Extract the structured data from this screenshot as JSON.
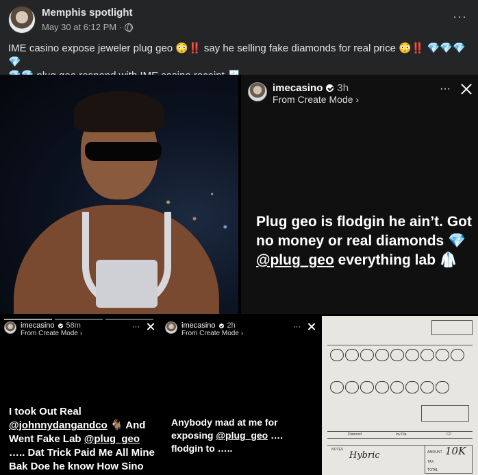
{
  "post": {
    "page_name": "Memphis spotlight",
    "date": "May 30 at 6:12 PM",
    "separator": "·",
    "more_label": "···",
    "caption_text_1": "IME casino expose jeweler plug geo 😳‼️ say he selling fake diamonds for real price 😳‼️ ",
    "caption_emoji_1": "💎💎💎💎",
    "caption_emoji_2": "💎💎",
    "caption_text_2": " plug geo respond with IME casino receipt 🧾"
  },
  "story_main": {
    "username": "imecasino",
    "time": "3h",
    "mode": "From Create Mode ›",
    "more_label": "···",
    "text_1": "Plug geo is flodgin he ain’t. Got no money or real diamonds 💎 ",
    "mention": "@plug_geo",
    "text_2": " everything lab 🥼"
  },
  "story_left": {
    "username": "imecasino",
    "time": "58m",
    "mode": "From Create Mode ›",
    "more_label": "···",
    "text_1": "I took Out Real ",
    "mention_1": "@johnnydangandco",
    "text_2": " 🐐 And Went Fake Lab ",
    "mention_2": "@plug_geo",
    "text_3": " ….. Dat Trick Paid Me All Mine Bak Doe he know How Sino Get"
  },
  "story_mid": {
    "username": "imecasino",
    "time": "2h",
    "mode": "From Create Mode ›",
    "more_label": "···",
    "text_1": "Anybody mad at me for exposing ",
    "mention": "@plug_geo",
    "text_2": " …. flodgin to ….."
  },
  "receipt": {
    "col_diamond": "Diamond",
    "col_inv": "Inv Dia",
    "col_c2": "C2",
    "notes_label": "NOTES",
    "handwritten_note": "Hybric",
    "amount_label": "AMOUNT",
    "amount_value": "10K",
    "tax_label": "TAX",
    "total_label": "TOTAL"
  }
}
